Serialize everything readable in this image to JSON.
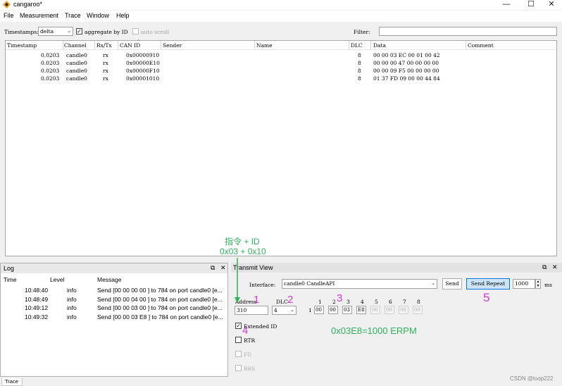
{
  "window": {
    "title": "cangaroo*",
    "minimize": "—",
    "maximize": "☐",
    "close": "✕"
  },
  "menu": [
    "File",
    "Measurement",
    "Trace",
    "Window",
    "Help"
  ],
  "toolbar": {
    "timestamps_label": "Timestamps:",
    "timestamps_value": "delta",
    "aggregate_label": "aggregate by ID",
    "aggregate_checked": true,
    "autoscroll_label": "auto scroll",
    "autoscroll_checked": false,
    "filter_label": "Filter:",
    "filter_value": ""
  },
  "trace": {
    "columns": [
      "Timestamp",
      "Channel",
      "Rx/Tx",
      "CAN ID",
      "Sender",
      "Name",
      "DLC",
      "Data",
      "Comment"
    ],
    "rows": [
      {
        "timestamp": "0.0203",
        "channel": "candle0",
        "rxtx": "rx",
        "can_id": "0x00000910",
        "sender": "",
        "name": "",
        "dlc": "8",
        "data": "00 00 03 EC 00 01 00 42",
        "comment": ""
      },
      {
        "timestamp": "0.0203",
        "channel": "candle0",
        "rxtx": "rx",
        "can_id": "0x00000E10",
        "sender": "",
        "name": "",
        "dlc": "8",
        "data": "00 00 00 47 00 00 00 00",
        "comment": ""
      },
      {
        "timestamp": "0.0203",
        "channel": "candle0",
        "rxtx": "rx",
        "can_id": "0x00000F10",
        "sender": "",
        "name": "",
        "dlc": "8",
        "data": "00 00 09 F5 00 00 00 00",
        "comment": ""
      },
      {
        "timestamp": "0.0203",
        "channel": "candle0",
        "rxtx": "rx",
        "can_id": "0x00001010",
        "sender": "",
        "name": "",
        "dlc": "8",
        "data": "01 37 FD 09 00 00 44 84",
        "comment": ""
      }
    ]
  },
  "log": {
    "title": "Log",
    "columns": [
      "Time",
      "Level",
      "Message"
    ],
    "rows": [
      {
        "time": "10:48:40",
        "level": "info",
        "message": "Send [00 00 00 00 ] to 784 on port candle0 [e..."
      },
      {
        "time": "10:48:49",
        "level": "info",
        "message": "Send [00 00 04 00 ] to 784 on port candle0 [e..."
      },
      {
        "time": "10:49:12",
        "level": "info",
        "message": "Send [00 00 03 00 ] to 784 on port candle0 [e..."
      },
      {
        "time": "10:49:32",
        "level": "info",
        "message": "Send [00 00 03 E8 ] to 784 on port candle0 [e..."
      }
    ]
  },
  "transmit": {
    "title": "Transmit View",
    "interface_label": "Interface:",
    "interface_value": "candle0 CandleAPI",
    "send_label": "Send",
    "send_repeat_label": "Send Repeat",
    "interval_value": "1000",
    "interval_unit": "ms",
    "address_label": "Address",
    "address_value": "310",
    "dlc_label": "DLC",
    "dlc_value": "4",
    "byte_numbers": [
      "1",
      "2",
      "3",
      "4",
      "5",
      "6",
      "7",
      "8"
    ],
    "row_index": "1",
    "bytes": [
      "00",
      "00",
      "03",
      "E8",
      "00",
      "00",
      "00",
      "00"
    ],
    "active_bytes": 4,
    "extended_id_label": "Extended ID",
    "extended_id_checked": true,
    "rtr_label": "RTR",
    "fd_label": "FD",
    "brs_label": "BRS"
  },
  "annotations": {
    "line1": "指令 + ID",
    "line2": "0x03  + 0x10",
    "erpm": "0x03E8=1000 ERPM",
    "n1": "1",
    "n2": "2",
    "n3": "3",
    "n4": "4",
    "n5": "5"
  },
  "status": {
    "tab": "Trace",
    "watermark": "CSDN @loop222"
  },
  "colors": {
    "annotation_pink": "#d837d8",
    "annotation_green": "#2db35b",
    "accent_button": "#cce4f7"
  }
}
